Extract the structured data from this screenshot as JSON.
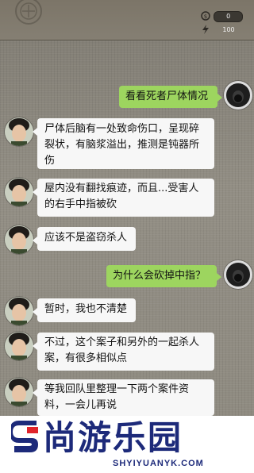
{
  "header": {
    "coins_value": "0",
    "energy_value": "100",
    "coins_icon": "coin-icon",
    "energy_icon": "lightning-icon"
  },
  "messages": [
    {
      "side": "right",
      "text": "看看死者尸体情况"
    },
    {
      "side": "left",
      "text": "尸体后脑有一处致命伤口，呈现碎裂状，有脑浆溢出，推测是钝器所伤"
    },
    {
      "side": "left",
      "text": "屋内没有翻找痕迹，而且...受害人的右手中指被砍"
    },
    {
      "side": "left",
      "text": "应该不是盗窃杀人"
    },
    {
      "side": "right",
      "text": "为什么会砍掉中指？"
    },
    {
      "side": "left",
      "text": "暂时，我也不清楚"
    },
    {
      "side": "left",
      "text": "不过，这个案子和另外的一起杀人案，有很多相似点"
    },
    {
      "side": "left",
      "text": "等我回队里整理一下两个案件资料，一会儿再说"
    }
  ],
  "watermark": {
    "title": "尚游乐园",
    "url": "SHYIYUANYK.COM"
  },
  "colors": {
    "right_bubble": "#9dd55f",
    "left_bubble": "#f7f7f7",
    "brand": "#1d2a7a",
    "brand_red": "#e0242b"
  }
}
